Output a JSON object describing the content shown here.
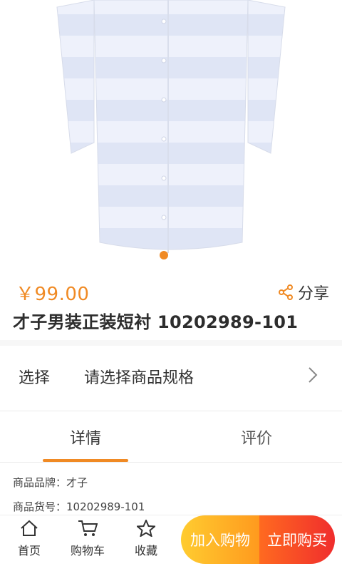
{
  "product": {
    "price": "￥99.00",
    "title": "才子男装正装短衬 10202989-101"
  },
  "share": {
    "label": "分享"
  },
  "spec": {
    "label": "选择",
    "value": "请选择商品规格"
  },
  "tabs": [
    {
      "label": "详情",
      "active": true
    },
    {
      "label": "评价",
      "active": false
    }
  ],
  "details": [
    {
      "text": "商品品牌：才子"
    },
    {
      "text": "商品货号：10202989-101"
    }
  ],
  "bottom_nav": [
    {
      "label": "首页",
      "icon": "home-icon"
    },
    {
      "label": "购物车",
      "icon": "cart-icon"
    },
    {
      "label": "收藏",
      "icon": "star-icon"
    }
  ],
  "actions": {
    "add_to_cart": "加入购物",
    "buy_now": "立即购买"
  },
  "colors": {
    "accent": "#f08a24",
    "buy": "#f02d2d",
    "cart": "#ffb224"
  }
}
